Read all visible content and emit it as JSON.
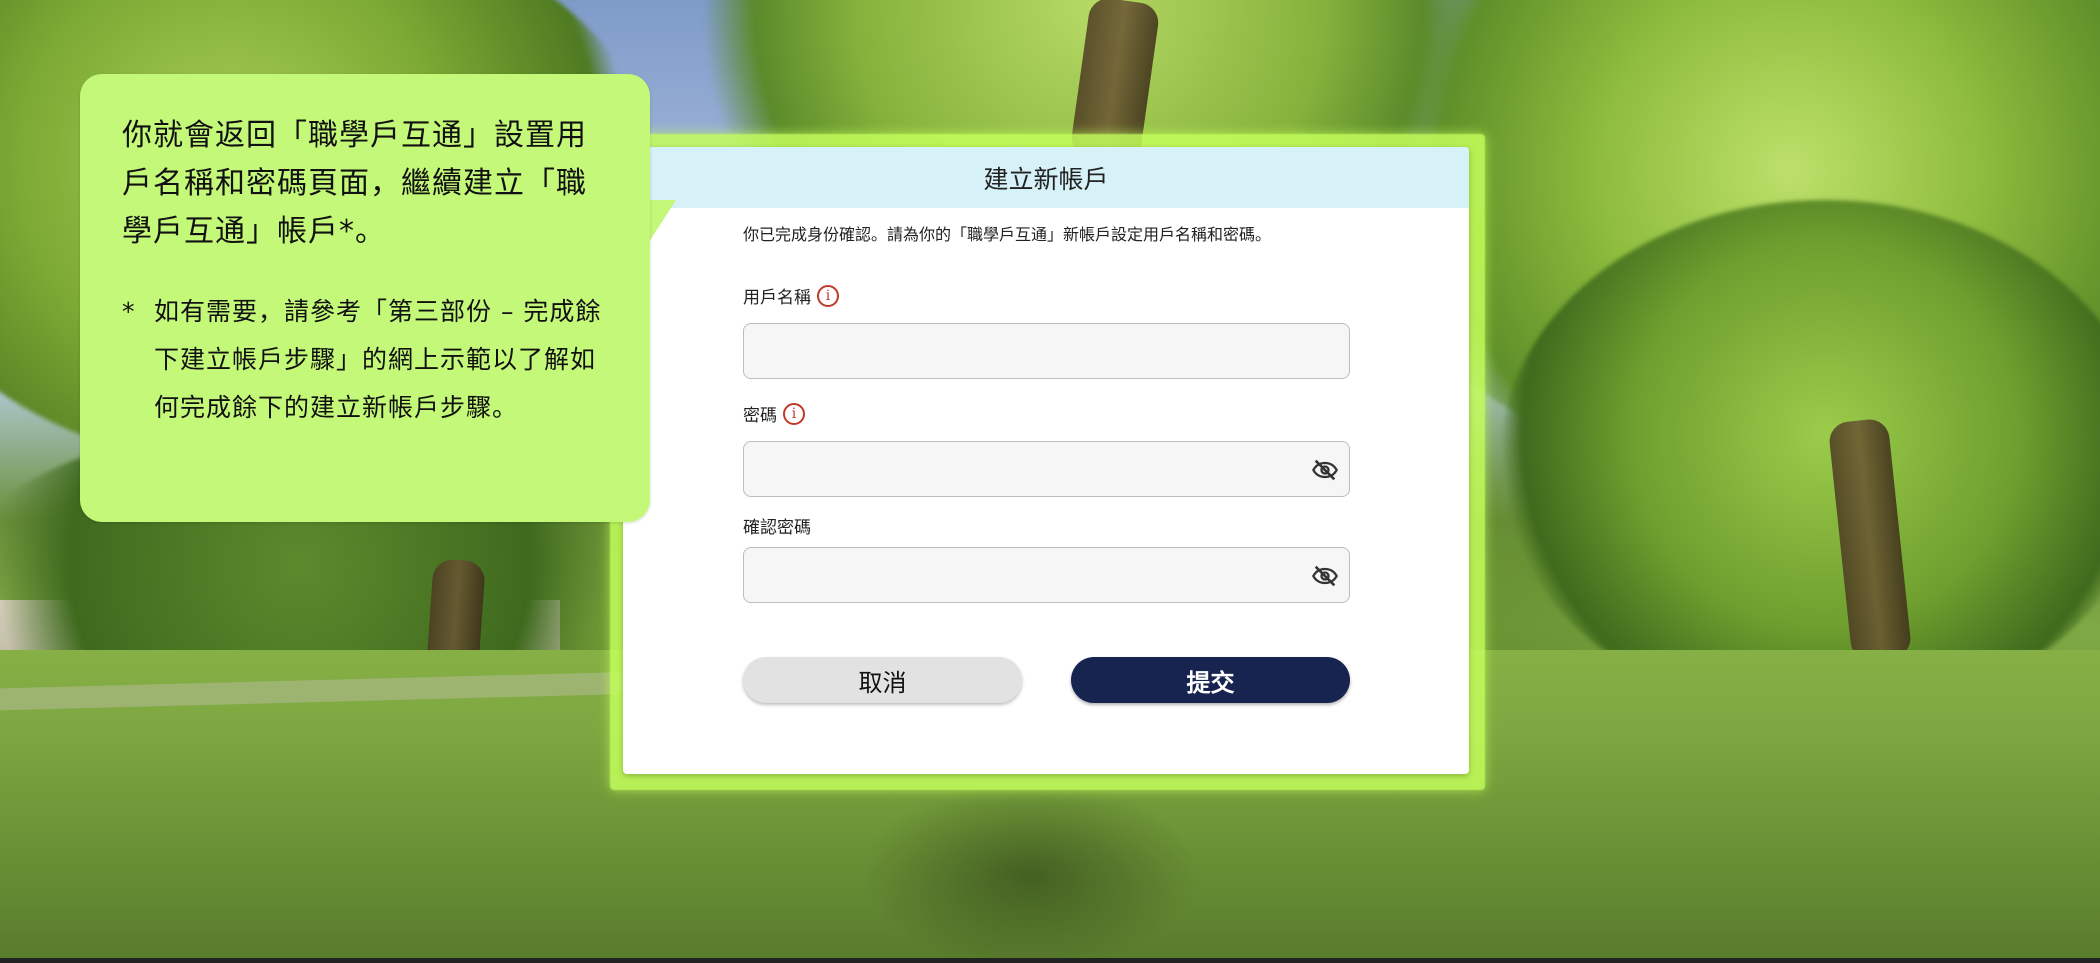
{
  "callout": {
    "main_text": "你就會返回「職學戶互通」設置用戶名稱和密碼頁面，繼續建立「職學戶互通」帳戶*。",
    "note_mark": "*",
    "note_text": "如有需要，請參考「第三部份 – 完成餘下建立帳戶步驟」的網上示範以了解如何完成餘下的建立新帳戶步驟。"
  },
  "form": {
    "title": "建立新帳戶",
    "intro": "你已完成身份確認。請為你的「職學戶互通」新帳戶設定用戶名稱和密碼。",
    "username": {
      "label": "用戶名稱",
      "value": "",
      "info_icon": "info-icon"
    },
    "password": {
      "label": "密碼",
      "value": "",
      "info_icon": "info-icon",
      "toggle_icon": "eye-slash-icon"
    },
    "confirm_password": {
      "label": "確認密碼",
      "value": "",
      "toggle_icon": "eye-slash-icon"
    },
    "cancel_label": "取消",
    "submit_label": "提交"
  },
  "colors": {
    "callout_bg": "#c4f878",
    "highlight_glow": "#c3ff5a",
    "header_bg": "#d6f1f8",
    "submit_bg": "#17244f",
    "cancel_bg": "#e2e2e2",
    "info_icon": "#c0392b"
  }
}
